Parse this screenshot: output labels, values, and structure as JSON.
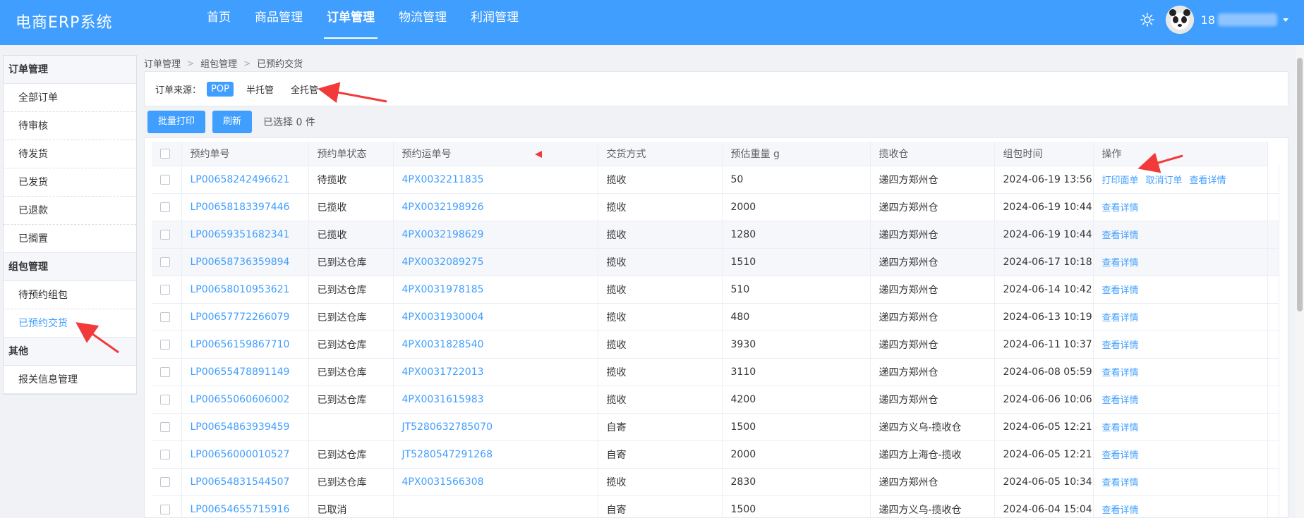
{
  "app": {
    "title": "电商ERP系统"
  },
  "nav": [
    {
      "label": "首页",
      "active": false
    },
    {
      "label": "商品管理",
      "active": false
    },
    {
      "label": "订单管理",
      "active": true
    },
    {
      "label": "物流管理",
      "active": false
    },
    {
      "label": "利润管理",
      "active": false
    }
  ],
  "user": {
    "name_visible": "18"
  },
  "sidebar": {
    "groups": [
      {
        "title": "订单管理",
        "items": [
          "全部订单",
          "待审核",
          "待发货",
          "已发货",
          "已退款",
          "已搁置"
        ]
      },
      {
        "title": "组包管理",
        "items": [
          "待预约组包",
          "已预约交货"
        ]
      },
      {
        "title": "其他",
        "items": [
          "报关信息管理"
        ]
      }
    ],
    "active_item": "已预约交货"
  },
  "breadcrumb": [
    "订单管理",
    "组包管理",
    "已预约交货"
  ],
  "filter": {
    "label": "订单来源：",
    "options": [
      "POP",
      "半托管",
      "全托管"
    ],
    "selected": "POP"
  },
  "toolbar": {
    "print_label": "批量打印",
    "refresh_label": "刷新",
    "selected_text": "已选择 0 件"
  },
  "table": {
    "columns": [
      "预约单号",
      "预约单状态",
      "预约运单号",
      "交货方式",
      "预估重量 g",
      "揽收仓",
      "组包时间",
      "操作"
    ],
    "rows": [
      {
        "id": "LP00658242496621",
        "status": "待揽收",
        "waybill": "4PX0032211835",
        "method": "揽收",
        "weight": "50",
        "warehouse": "递四方郑州仓",
        "time": "2024-06-19 13:56",
        "ops": [
          "打印面单",
          "取消订单",
          "查看详情"
        ]
      },
      {
        "id": "LP00658183397446",
        "status": "已揽收",
        "waybill": "4PX0032198926",
        "method": "揽收",
        "weight": "2000",
        "warehouse": "递四方郑州仓",
        "time": "2024-06-19 10:44",
        "ops": [
          "查看详情"
        ]
      },
      {
        "id": "LP00659351682341",
        "status": "已揽收",
        "waybill": "4PX0032198629",
        "method": "揽收",
        "weight": "1280",
        "warehouse": "递四方郑州仓",
        "time": "2024-06-19 10:44",
        "ops": [
          "查看详情"
        ]
      },
      {
        "id": "LP00658736359894",
        "status": "已到达仓库",
        "waybill": "4PX0032089275",
        "method": "揽收",
        "weight": "1510",
        "warehouse": "递四方郑州仓",
        "time": "2024-06-17 10:18",
        "ops": [
          "查看详情"
        ]
      },
      {
        "id": "LP00658010953621",
        "status": "已到达仓库",
        "waybill": "4PX0031978185",
        "method": "揽收",
        "weight": "510",
        "warehouse": "递四方郑州仓",
        "time": "2024-06-14 10:42",
        "ops": [
          "查看详情"
        ]
      },
      {
        "id": "LP00657772266079",
        "status": "已到达仓库",
        "waybill": "4PX0031930004",
        "method": "揽收",
        "weight": "480",
        "warehouse": "递四方郑州仓",
        "time": "2024-06-13 10:19",
        "ops": [
          "查看详情"
        ]
      },
      {
        "id": "LP00656159867710",
        "status": "已到达仓库",
        "waybill": "4PX0031828540",
        "method": "揽收",
        "weight": "3930",
        "warehouse": "递四方郑州仓",
        "time": "2024-06-11 10:37",
        "ops": [
          "查看详情"
        ]
      },
      {
        "id": "LP00655478891149",
        "status": "已到达仓库",
        "waybill": "4PX0031722013",
        "method": "揽收",
        "weight": "3110",
        "warehouse": "递四方郑州仓",
        "time": "2024-06-08 05:59",
        "ops": [
          "查看详情"
        ]
      },
      {
        "id": "LP00655060606002",
        "status": "已到达仓库",
        "waybill": "4PX0031615983",
        "method": "揽收",
        "weight": "4200",
        "warehouse": "递四方郑州仓",
        "time": "2024-06-06 10:06",
        "ops": [
          "查看详情"
        ]
      },
      {
        "id": "LP00654863939459",
        "status": "",
        "waybill": "JT5280632785070",
        "method": "自寄",
        "weight": "1500",
        "warehouse": "递四方义乌-揽收仓",
        "time": "2024-06-05 12:21",
        "ops": [
          "查看详情"
        ]
      },
      {
        "id": "LP00656000010527",
        "status": "已到达仓库",
        "waybill": "JT5280547291268",
        "method": "自寄",
        "weight": "2000",
        "warehouse": "递四方上海仓-揽收",
        "time": "2024-06-05 12:21",
        "ops": [
          "查看详情"
        ]
      },
      {
        "id": "LP00654831544507",
        "status": "已到达仓库",
        "waybill": "4PX0031566308",
        "method": "揽收",
        "weight": "2830",
        "warehouse": "递四方郑州仓",
        "time": "2024-06-05 10:34",
        "ops": [
          "查看详情"
        ]
      },
      {
        "id": "LP00654655715916",
        "status": "已取消",
        "waybill": "",
        "method": "自寄",
        "weight": "1500",
        "warehouse": "递四方义乌-揽收仓",
        "time": "2024-06-04 15:04",
        "ops": [
          "查看详情"
        ]
      }
    ]
  },
  "colors": {
    "primary": "#409eff",
    "annotation": "#f23a3a"
  }
}
